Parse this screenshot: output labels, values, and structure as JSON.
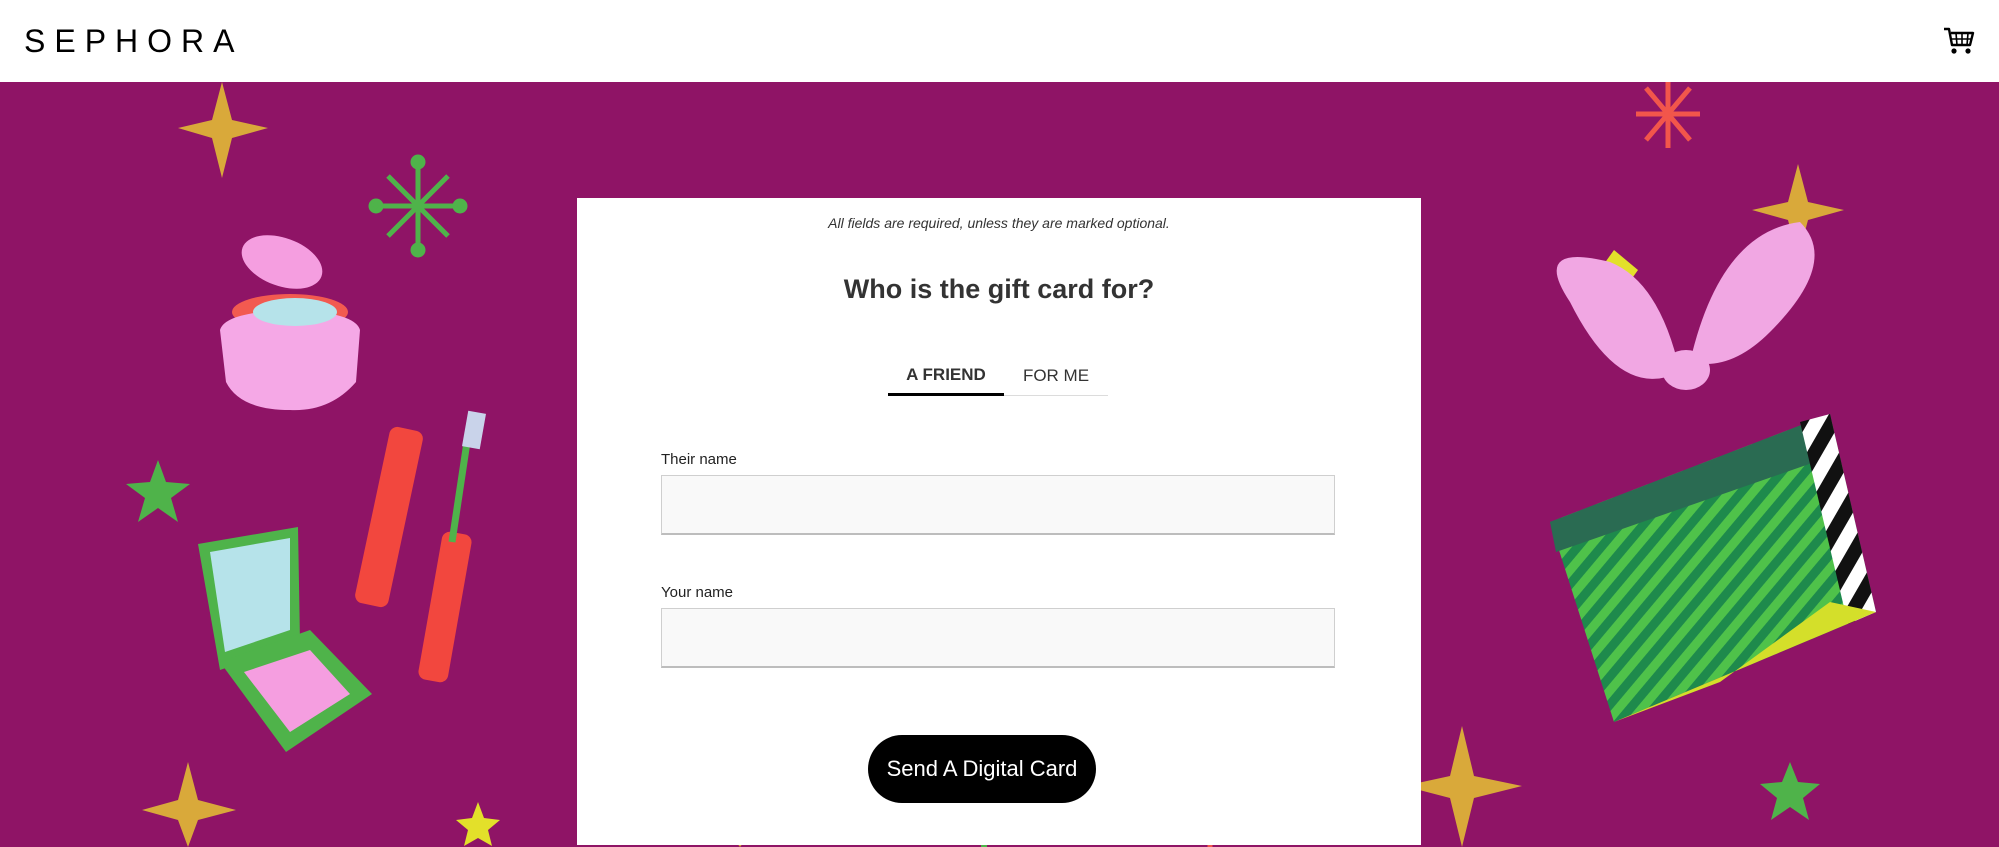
{
  "header": {
    "logo": "SEPHORA",
    "cart_icon": "shopping-cart-icon"
  },
  "form": {
    "note": "All fields are required, unless they are marked optional.",
    "title": "Who is the gift card for?",
    "tabs": [
      {
        "label": "A FRIEND",
        "selected": true
      },
      {
        "label": "FOR ME",
        "selected": false
      }
    ],
    "their_name": {
      "label": "Their name",
      "value": "",
      "placeholder": ""
    },
    "your_name": {
      "label": "Your name",
      "value": "",
      "placeholder": ""
    },
    "submit_label": "Send A Digital Card"
  },
  "colors": {
    "background_magenta": "#8f1466",
    "button": "#000000",
    "gold": "#d9a93a",
    "green": "#4fb34a",
    "coral": "#f2564b",
    "pink": "#f1a7e3"
  }
}
